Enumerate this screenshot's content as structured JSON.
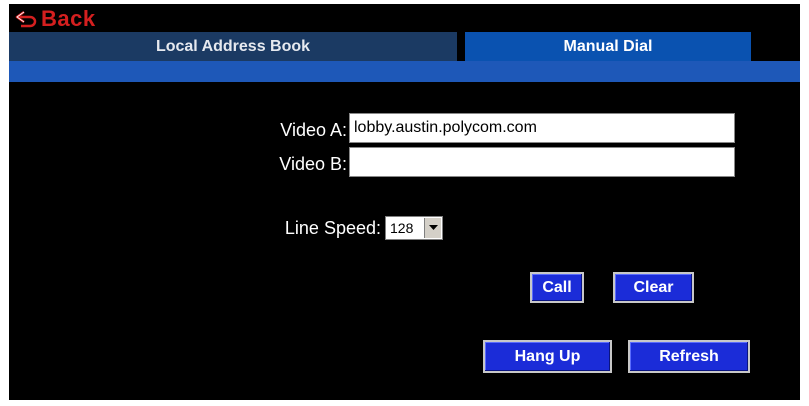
{
  "header": {
    "back_label": "Back",
    "back_icon": "back-arrow-icon",
    "accent_color": "#d41f1f"
  },
  "tabs": [
    {
      "label": "Local Address Book",
      "active": false
    },
    {
      "label": "Manual Dial",
      "active": true
    }
  ],
  "form": {
    "video_a_label": "Video A:",
    "video_a_value": "lobby.austin.polycom.com",
    "video_b_label": "Video B:",
    "video_b_value": "",
    "line_speed_label": "Line Speed:",
    "line_speed_value": "128",
    "line_speed_arrow_icon": "chevron-down-icon"
  },
  "buttons": {
    "call": "Call",
    "clear": "Clear",
    "hang_up": "Hang Up",
    "refresh": "Refresh"
  },
  "colors": {
    "background": "#000000",
    "tab_active": "#0a52b0",
    "tab_inactive": "#1b3a63",
    "button": "#1b2cd8"
  }
}
